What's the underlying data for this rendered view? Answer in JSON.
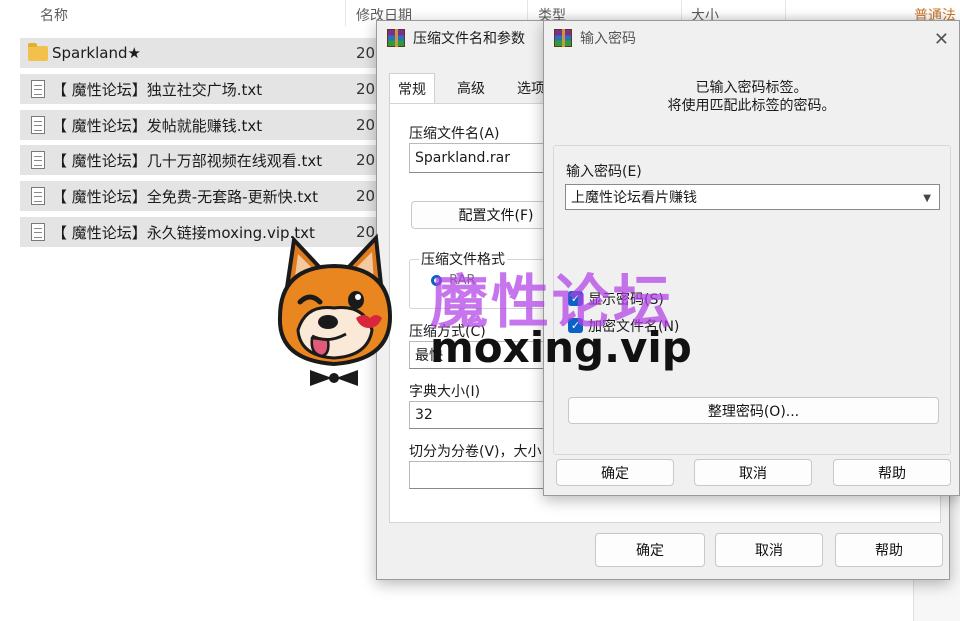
{
  "explorer": {
    "columns": {
      "name": "名称",
      "date": "修改日期",
      "type": "类型",
      "size": "大小",
      "extra": "普通法"
    },
    "files": [
      {
        "name": "Sparkland★",
        "date": "20",
        "icon": "folder-icon"
      },
      {
        "name": "【 魔性论坛】独立社交广场.txt",
        "date": "20",
        "icon": "txt-file-icon"
      },
      {
        "name": "【 魔性论坛】发帖就能赚钱.txt",
        "date": "20",
        "icon": "txt-file-icon"
      },
      {
        "name": "【 魔性论坛】几十万部视频在线观看.txt",
        "date": "20",
        "icon": "txt-file-icon"
      },
      {
        "name": "【 魔性论坛】全免费-无套路-更新快.txt",
        "date": "20",
        "icon": "txt-file-icon"
      },
      {
        "name": "【 魔性论坛】永久链接moxing.vip.txt",
        "date": "20",
        "icon": "txt-file-icon"
      }
    ]
  },
  "archive_dialog": {
    "title": "压缩文件名和参数",
    "tabs": [
      "常规",
      "高级",
      "选项"
    ],
    "archive_name_label": "压缩文件名(A)",
    "archive_name_value": "Sparkland.rar",
    "profiles_button": "配置文件(F)",
    "format_label": "压缩文件格式",
    "format_option": "RAR",
    "method_label": "压缩方式(C)",
    "method_value": "最快",
    "dictionary_label": "字典大小(I)",
    "dictionary_value": "32",
    "split_label": "切分为分卷(V)，大小",
    "ok_button": "确定",
    "cancel_button": "取消",
    "help_button": "帮助"
  },
  "password_dialog": {
    "title": "输入密码",
    "info_line1": "已输入密码标签。",
    "info_line2": "将使用匹配此标签的密码。",
    "password_label": "输入密码(E)",
    "password_value": "上魔性论坛看片赚钱",
    "show_password_label": "显示密码(S)",
    "encrypt_filenames_label": "加密文件名(N)",
    "organize_button": "整理密码(O)...",
    "ok_button": "确定",
    "cancel_button": "取消",
    "help_button": "帮助",
    "show_password_checked": true,
    "encrypt_filenames_checked": true
  },
  "watermark": {
    "title": "魔性论坛",
    "url": "moxing.vip"
  }
}
